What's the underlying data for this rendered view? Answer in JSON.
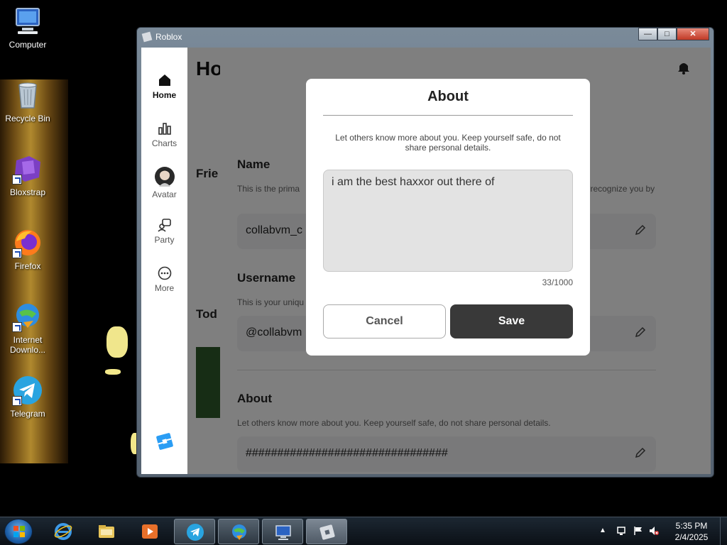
{
  "desktop": {
    "icons": [
      {
        "label": "Computer"
      },
      {
        "label": "Recycle Bin"
      },
      {
        "label": "Bloxstrap"
      },
      {
        "label": "Firefox"
      },
      {
        "label": "Internet Downlo..."
      },
      {
        "label": "Telegram"
      }
    ]
  },
  "window": {
    "title": "Roblox",
    "buttons": [
      "minimize-icon",
      "maximize-icon",
      "close-icon"
    ]
  },
  "sidebar": {
    "items": [
      {
        "label": "Home",
        "icon": "home-icon",
        "active": true
      },
      {
        "label": "Charts",
        "icon": "charts-icon",
        "active": false
      },
      {
        "label": "Avatar",
        "icon": "avatar-icon",
        "active": false
      },
      {
        "label": "Party",
        "icon": "party-icon",
        "active": false
      },
      {
        "label": "More",
        "icon": "more-icon",
        "active": false
      }
    ]
  },
  "background": {
    "page_title": "Ho",
    "side_headings": [
      "Frie",
      "Tod"
    ]
  },
  "profile": {
    "name": {
      "title": "Name",
      "desc": "This is the prima                                                                                                 your friends will recognize you by",
      "value": "collabvm_c"
    },
    "username": {
      "title": "Username",
      "desc": "This is your uniqu",
      "value": "@collabvm"
    },
    "about": {
      "title": "About",
      "desc": "Let others know more about you. Keep yourself safe, do not share personal details.",
      "value": "################################"
    }
  },
  "modal": {
    "title": "About",
    "description": "Let others know more about you. Keep yourself safe, do not share personal details.",
    "textarea_value": "i am the best haxxor out there of",
    "char_count": "33/1000",
    "cancel_label": "Cancel",
    "save_label": "Save"
  },
  "taskbar": {
    "time": "5:35 PM",
    "date": "2/4/2025"
  },
  "colors": {
    "save_button": "#393939",
    "roblox_logo": "#2a9df4"
  }
}
